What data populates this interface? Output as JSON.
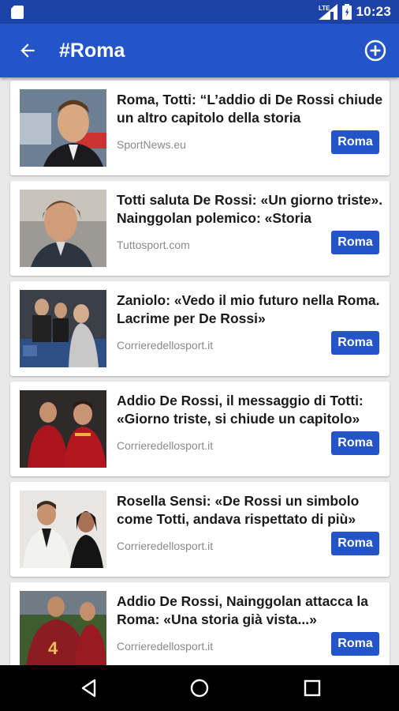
{
  "status_bar": {
    "time": "10:23",
    "network_label": "LTE"
  },
  "app_bar": {
    "title": "#Roma"
  },
  "articles": [
    {
      "headline": "Roma, Totti: “L’addio di De Rossi chiude un altro capitolo della storia",
      "source": "SportNews.eu",
      "tag": "Roma"
    },
    {
      "headline": "Totti saluta De Rossi: «Un giorno triste». Nainggolan polemico: «Storia",
      "source": "Tuttosport.com",
      "tag": "Roma"
    },
    {
      "headline": "Zaniolo: «Vedo il mio futuro nella Roma. Lacrime per De Rossi»",
      "source": "Corrieredellosport.it",
      "tag": "Roma"
    },
    {
      "headline": "Addio De Rossi, il messaggio di Totti: «Giorno triste, si chiude un capitolo»",
      "source": "Corrieredellosport.it",
      "tag": "Roma"
    },
    {
      "headline": "Rosella Sensi: «De Rossi un simbolo come Totti, andava rispettato di più»",
      "source": "Corrieredellosport.it",
      "tag": "Roma"
    },
    {
      "headline": "Addio De Rossi, Nainggolan attacca la Roma: «Una storia già vista...»",
      "source": "Corrieredellosport.it",
      "tag": "Roma"
    }
  ],
  "colors": {
    "primary": "#2455c8",
    "status_bar": "#1e43a8",
    "background": "#e9e9e9"
  },
  "icons": {
    "status_left": "sim-card-icon",
    "network": "cellular-signal-icon",
    "battery": "battery-icon",
    "back": "arrow-left-icon",
    "add": "add-circle-icon",
    "nav_back": "triangle-back-icon",
    "nav_home": "circle-home-icon",
    "nav_recents": "square-recents-icon"
  }
}
